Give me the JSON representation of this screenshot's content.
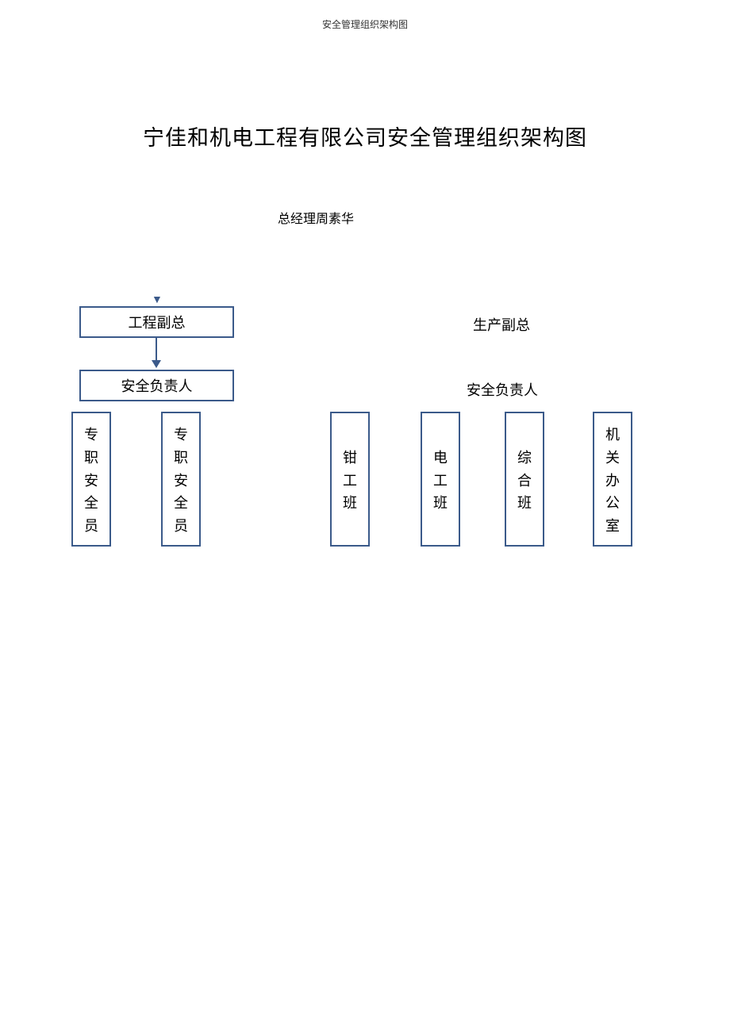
{
  "header": "安全管理组织架构图",
  "title": "宁佳和机电工程有限公司安全管理组织架构图",
  "general_manager": "总经理周素华",
  "left": {
    "vp": "工程副总",
    "safety_lead": "安全负责人",
    "staff": [
      "专职安全员",
      "专职安全员"
    ]
  },
  "right": {
    "vp": "生产副总",
    "safety_lead": "安全负责人",
    "teams": [
      "钳工班",
      "电工班",
      "综合班",
      "机关办公室"
    ]
  },
  "chart_data": {
    "type": "diagram",
    "structure": "org-chart",
    "root": "总经理周素华",
    "children": [
      {
        "label": "工程副总",
        "children": [
          {
            "label": "安全负责人",
            "children": [
              {
                "label": "专职安全员"
              },
              {
                "label": "专职安全员"
              }
            ]
          }
        ]
      },
      {
        "label": "生产副总",
        "children": [
          {
            "label": "安全负责人",
            "children": [
              {
                "label": "钳工班"
              },
              {
                "label": "电工班"
              },
              {
                "label": "综合班"
              },
              {
                "label": "机关办公室"
              }
            ]
          }
        ]
      }
    ]
  }
}
